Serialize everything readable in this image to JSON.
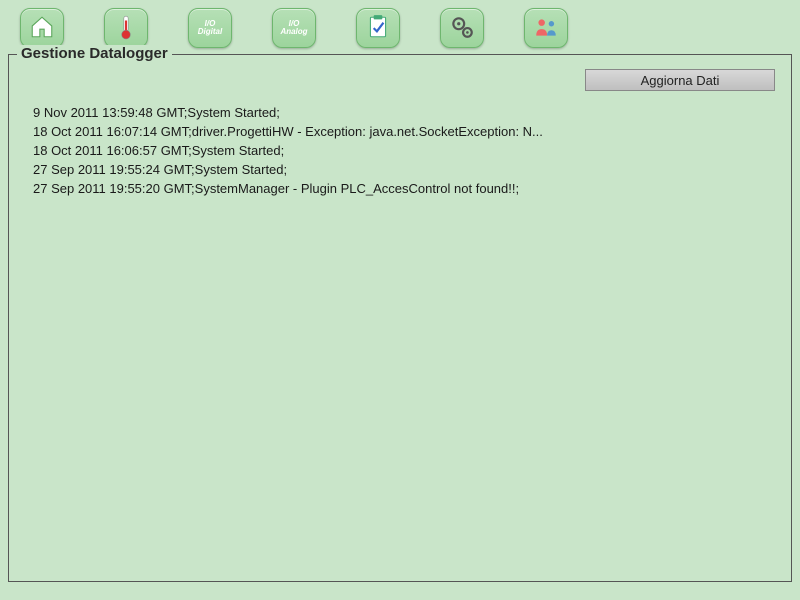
{
  "toolbar": {
    "home": {
      "name": "home-button"
    },
    "temp": {
      "name": "temperature-button"
    },
    "ioDigital": {
      "name": "io-digital-button",
      "label1": "I/O",
      "label2": "Digital"
    },
    "ioAnalog": {
      "name": "io-analog-button",
      "label1": "I/O",
      "label2": "Analog"
    },
    "log": {
      "name": "datalogger-button"
    },
    "settings": {
      "name": "settings-button"
    },
    "users": {
      "name": "users-button"
    }
  },
  "panel": {
    "title": "Gestione Datalogger",
    "refresh_label": "Aggiorna Dati"
  },
  "log_lines": [
    "9 Nov 2011 13:59:48 GMT;System Started;",
    "18 Oct 2011 16:07:14 GMT;driver.ProgettiHW - Exception: java.net.SocketException: N...",
    "18 Oct 2011 16:06:57 GMT;System Started;",
    "27 Sep 2011 19:55:24 GMT;System Started;",
    "27 Sep 2011 19:55:20 GMT;SystemManager - Plugin PLC_AccesControl not found!!;"
  ]
}
